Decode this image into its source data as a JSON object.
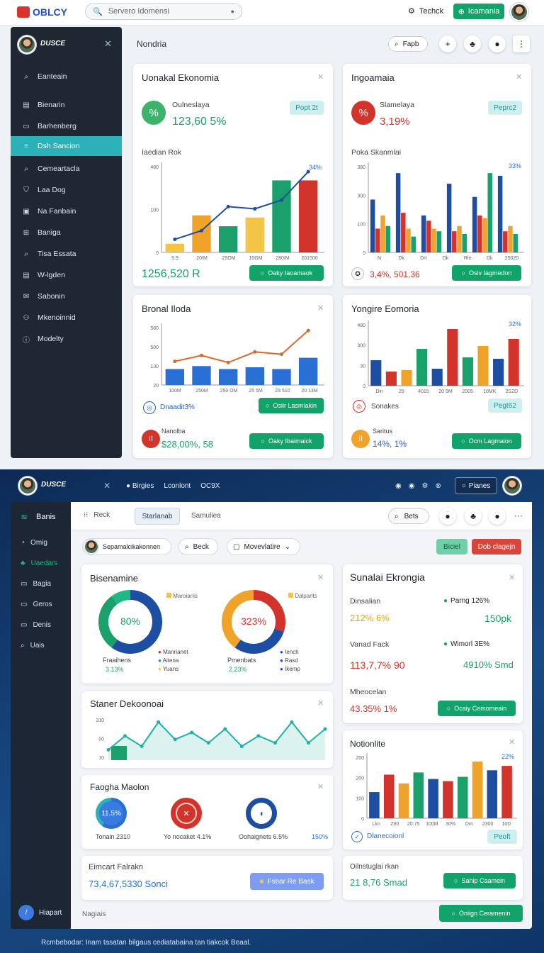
{
  "top": {
    "logo": "OBLCY",
    "search_placeholder": "Servero Idomensi",
    "link": "Techck",
    "cta": "Icamania"
  },
  "sidebar": {
    "user": "DUSCE",
    "items": [
      {
        "label": "Eanteain",
        "icon": "search-icon"
      },
      {
        "label": "Bienarin",
        "icon": "calendar-icon"
      },
      {
        "label": "Barhenberg",
        "icon": "folder-icon"
      },
      {
        "label": "Dsh Sancion",
        "icon": "menu-icon"
      },
      {
        "label": "Cemeartacla",
        "icon": "search-icon"
      },
      {
        "label": "Laa Dog",
        "icon": "shield-icon"
      },
      {
        "label": "Na Fanbain",
        "icon": "briefcase-icon"
      },
      {
        "label": "Baniga",
        "icon": "grid-icon"
      },
      {
        "label": "Tisa Essata",
        "icon": "search-icon"
      },
      {
        "label": "W-lgden",
        "icon": "document-icon"
      },
      {
        "label": "Sabonin",
        "icon": "mail-icon"
      },
      {
        "label": "Mkenoinnid",
        "icon": "users-icon"
      },
      {
        "label": "Modelty",
        "icon": "info-icon"
      }
    ]
  },
  "header": {
    "title": "Nondria",
    "search": "Fapb"
  },
  "c1": {
    "title": "Uonakal Ekonomia",
    "sub": "Oulneslaya",
    "metric": "123,60 5%",
    "badge": "Popt 2t",
    "chart_label": "Iaedian Rok",
    "footer_value": "1256,520 R",
    "button": "Oaky Iaoamaok"
  },
  "c2": {
    "title": "Ingoamaia",
    "sub": "Slamelaya",
    "metric": "3,19%",
    "badge": "Peprc2",
    "chart_label": "Poka Skanmlai",
    "footer_value": "3,4%, 501,36",
    "button": "Osiv Iagmedon"
  },
  "c3": {
    "title": "Bronal Iloda",
    "footer_value": "Dnaadit3%",
    "button": "Osiir Lasmiakin",
    "mini_label": "Nanolba",
    "mini_value": "$28,00%, 58",
    "mini_button": "Oaky Ibaimaick"
  },
  "c4": {
    "title": "Yongire Eomoria",
    "footer_value": "Sonakes",
    "badge": "Pegt62",
    "mini_label": "Saritus",
    "mini_value": "14%, 1%",
    "mini_button": "Ocm Lagmaion"
  },
  "dark_header": {
    "user": "DUSCE",
    "links": [
      "Birgies",
      "Lconlont",
      "OC9X"
    ],
    "right_label": "Pianes"
  },
  "dark_sidebar": {
    "title": "Banis",
    "items": [
      "Omig",
      "Uaedars",
      "Bagia",
      "Geros",
      "Denis",
      "Uais"
    ],
    "bottom": "Hiapart"
  },
  "dash": {
    "tabs": [
      "Reck",
      "Starlanab",
      "Samuliea"
    ],
    "search": "Bets",
    "user": "Sepamalcikakonnen",
    "filter1": "Beck",
    "filter2": "Movevlatire",
    "btn1": "Biciel",
    "btn2": "Dob clagejn"
  },
  "donuts": {
    "title": "Bisenamine",
    "left_pct": "80%",
    "left_legend": "Maroianis",
    "left_caption": "Fraaihens",
    "left_value": "3.13%",
    "left_items": [
      "Manrianet",
      "Aitena",
      "Yuans"
    ],
    "right_pct": "323%",
    "right_legend": "Dalparits",
    "right_caption": "Pmenbats",
    "right_value": "2.23%",
    "right_items": [
      "Iench",
      "Rasd",
      "Ikemp"
    ]
  },
  "summary": {
    "title": "Sunalai Ekrongia",
    "r1_label": "Dinsalian",
    "r1_value": "212% 6%",
    "r1_tag": "Parng 126%",
    "r1_right": "150pk",
    "r2_label": "Vanad Fack",
    "r2_value": "113,7,7% 90",
    "r2_tag": "Wimorl 3E%",
    "r2_right": "4910% Smd",
    "r3_label": "Mheocelan",
    "r3_value": "43.35% 1%",
    "button": "Ocaiy Cemomeain"
  },
  "line": {
    "title": "Staner Dekoonoai"
  },
  "gauges": {
    "title": "Faogha Maolon",
    "g1": "11.5%",
    "g1_caption": "Tonain 2310",
    "g2_caption": "Yo nocaket 4.1%",
    "g3_caption": "Oohaignets 6.5%",
    "g4_caption": "150%"
  },
  "bars": {
    "title": "Notionlite",
    "footer": "Dlanecoionl",
    "badge": "Peoft"
  },
  "foot1": {
    "label": "Eimcart Falrakn",
    "value": "73,4,67,5330 Sonci",
    "button": "Fsbar Re Bask"
  },
  "foot2": {
    "label": "Oilnstuglai rkan",
    "value": "21 8,76 Smad",
    "button": "Sahip Caamein"
  },
  "bottom": {
    "left": "Nagiais",
    "right_button": "Oniign Ceramenin",
    "caption": "Rcmbebodar: Inam tasatan bilgaus cediatabaina tan tiakcok Beaal."
  },
  "chart_data": [
    {
      "type": "bar",
      "title": "Iaedian Rok",
      "categories": [
        "5.9",
        "20IM",
        "25OM",
        "10GM",
        "280IM",
        "201500"
      ],
      "values": [
        40,
        170,
        120,
        160,
        330,
        330
      ],
      "line": [
        60,
        100,
        210,
        200,
        240,
        370
      ],
      "ylim": [
        0,
        400
      ],
      "yticks": [
        "480",
        "100",
        "0"
      ],
      "annotation": "34%"
    },
    {
      "type": "bar",
      "title": "Poka Skanmlai",
      "categories": [
        "N",
        "Dk",
        "Drt",
        "Dk",
        "Rle",
        "Dk",
        "25020"
      ],
      "series": [
        {
          "name": "blue",
          "values": [
            200,
            300,
            140,
            260,
            210,
            290
          ]
        },
        {
          "name": "red",
          "values": [
            90,
            150,
            120,
            80,
            140,
            80
          ]
        },
        {
          "name": "orange",
          "values": [
            140,
            90,
            90,
            100,
            130,
            100
          ]
        },
        {
          "name": "green",
          "values": [
            100,
            60,
            80,
            70,
            300,
            70
          ]
        }
      ],
      "ylim": [
        0,
        350
      ],
      "yticks": [
        "380",
        "300",
        "100",
        "0"
      ],
      "annotation": "33%"
    },
    {
      "type": "bar",
      "title": "Bronal Iloda",
      "categories": [
        "100M",
        "250M",
        "250 OM",
        "25 5M",
        "23 510",
        "20 13M"
      ],
      "values": [
        270,
        320,
        270,
        300,
        270,
        460
      ],
      "line": [
        400,
        500,
        380,
        560,
        520,
        920
      ],
      "yticks": [
        "580",
        "500",
        "130",
        "20"
      ]
    },
    {
      "type": "bar",
      "title": "Yongire Eomoria",
      "categories": [
        "Din",
        "25",
        "4015",
        "20 5M",
        "2005",
        "10MK",
        "2S2D"
      ],
      "values": [
        180,
        100,
        110,
        260,
        120,
        400,
        200,
        280,
        190,
        330
      ],
      "yticks": [
        "480",
        "300",
        "30",
        "0"
      ],
      "annotation": "32%"
    },
    {
      "type": "line",
      "title": "Staner Dekoonoai",
      "values": [
        3,
        7,
        4,
        11,
        6,
        8,
        5,
        9,
        4,
        7,
        5,
        11,
        5,
        9
      ],
      "yticks": [
        "310",
        "00",
        "10"
      ]
    },
    {
      "type": "bar",
      "title": "Notionlite",
      "categories": [
        "Lkn",
        "Z60",
        "20 75",
        "100M",
        "30%",
        "Dm",
        "2300",
        "10D"
      ],
      "values": [
        120,
        200,
        160,
        210,
        180,
        170,
        190,
        260,
        220,
        240
      ],
      "yticks": [
        "200",
        "200",
        "100",
        "0"
      ],
      "annotation": "22%"
    },
    {
      "type": "pie",
      "title": "Bisenamine",
      "slices": [
        {
          "name": "Manrianet",
          "value": 60
        },
        {
          "name": "Aitena",
          "value": 30
        },
        {
          "name": "Yuans",
          "value": 10
        }
      ]
    },
    {
      "type": "pie",
      "title": "Bisenamine-2",
      "slices": [
        {
          "name": "Iench",
          "value": 30
        },
        {
          "name": "Rasd",
          "value": 30
        },
        {
          "name": "Ikemp",
          "value": 40
        }
      ]
    }
  ]
}
